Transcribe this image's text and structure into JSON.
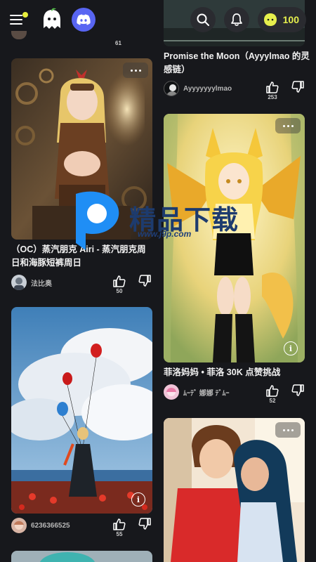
{
  "header": {
    "coin_value": "100",
    "icons": [
      "menu-icon",
      "ghost-logo-icon",
      "discord-icon",
      "search-icon",
      "bell-icon",
      "coin-icon"
    ]
  },
  "feed": {
    "left": [
      {
        "title": "",
        "like_count": "61",
        "partial": true
      },
      {
        "title": "（OC）蒸汽朋克 Airi - 蒸汽朋克周日和海豚短裤周日",
        "author": "法比奥",
        "like_count": "50"
      },
      {
        "title": "",
        "author": "6236366525",
        "like_count": "55"
      }
    ],
    "right": [
      {
        "title": "Promise the Moon（Ayyylmao 的灵感链）",
        "author": "Ayyyyyyylmao",
        "like_count": "253"
      },
      {
        "title": "菲洛妈妈 • 菲洛 30K 点赞挑战",
        "author": "ﾑｰﾃﾞ 娜娜 ﾃﾞﾑｰ",
        "like_count": "52"
      },
      {
        "title": "",
        "author": "",
        "like_count": ""
      }
    ]
  },
  "watermark": {
    "text": "精品下载",
    "url": "www.j9p.com"
  },
  "colors": {
    "background": "#17181c",
    "accent": "#e6ef4d",
    "discord": "#5865f2"
  }
}
